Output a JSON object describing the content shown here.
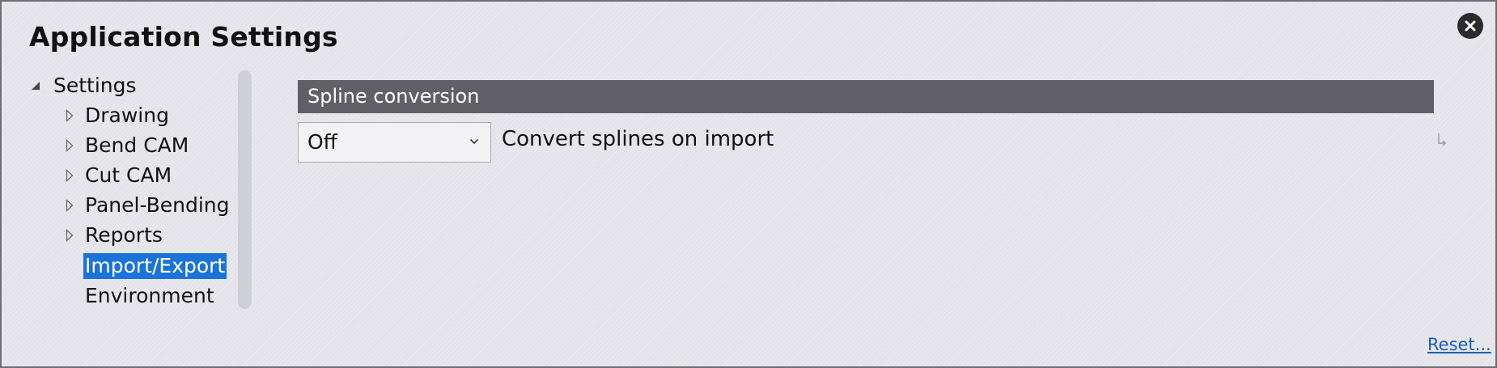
{
  "window": {
    "title": "Application Settings"
  },
  "tree": {
    "root_label": "Settings",
    "items": [
      {
        "label": "Drawing"
      },
      {
        "label": "Bend CAM"
      },
      {
        "label": "Cut CAM"
      },
      {
        "label": "Panel-Bending"
      },
      {
        "label": "Reports"
      },
      {
        "label": "Import/Export"
      },
      {
        "label": "Environment"
      }
    ],
    "selected_item": "Import/Export"
  },
  "section": {
    "header": "Spline conversion",
    "dropdown_value": "Off",
    "setting_label": "Convert splines on import"
  },
  "footer": {
    "reset_label": "Reset..."
  },
  "colors": {
    "selection": "#1a73d9",
    "section_header": "#606066",
    "link": "#1a5fb4"
  }
}
